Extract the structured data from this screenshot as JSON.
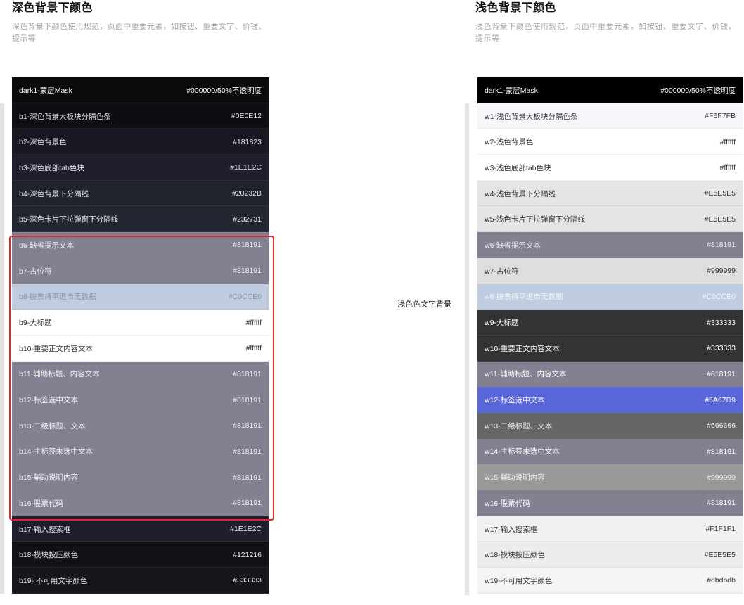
{
  "dark_panel": {
    "title": "深色背景下颜色",
    "description": "深色背景下颜色使用规范，页面中重要元素，如按钮、重要文字、价钱、提示等",
    "rows": [
      {
        "label": "dark1-蒙层Mask",
        "value": "#000000/50%不透明度",
        "bg": "#0b0b0e",
        "fg": "#ffffff"
      },
      {
        "label": "b1-深色背景大板块分隔色条",
        "value": "#0E0E12",
        "bg": "#0E0E12",
        "fg": "#e8e8ec"
      },
      {
        "label": "b2-深色背景色",
        "value": "#181823",
        "bg": "#181823",
        "fg": "#e8e8ec"
      },
      {
        "label": "b3-深色底部tab色块",
        "value": "#1E1E2C",
        "bg": "#1E1E2C",
        "fg": "#e8e8ec"
      },
      {
        "label": "b4-深色背景下分隔线",
        "value": "#20232B",
        "bg": "#20232B",
        "fg": "#e8e8ec"
      },
      {
        "label": "b5-深色卡片下拉弹窗下分隔线",
        "value": "#232731",
        "bg": "#232731",
        "fg": "#e8e8ec"
      },
      {
        "label": "b6-缺省提示文本",
        "value": "#818191",
        "bg": "#818191",
        "fg": "#f4f4f7"
      },
      {
        "label": "b7-占位符",
        "value": "#818191",
        "bg": "#818191",
        "fg": "#f4f4f7"
      },
      {
        "label": "b8-股票持平退市无数据",
        "value": "#C0CCE0",
        "bg": "#C0CCE0",
        "fg": "#8893a6"
      },
      {
        "label": "b9-大标题",
        "value": "#ffffff",
        "bg": "#ffffff",
        "fg": "#333333"
      },
      {
        "label": "b10-重要正文内容文本",
        "value": "#ffffff",
        "bg": "#ffffff",
        "fg": "#333333"
      },
      {
        "label": "b11-辅助标题、内容文本",
        "value": "#818191",
        "bg": "#818191",
        "fg": "#f4f4f7"
      },
      {
        "label": "b12-标签选中文本",
        "value": "#818191",
        "bg": "#818191",
        "fg": "#f4f4f7"
      },
      {
        "label": "b13-二级标题、文本",
        "value": "#818191",
        "bg": "#818191",
        "fg": "#f4f4f7"
      },
      {
        "label": "b14-主标签未选中文本",
        "value": "#818191",
        "bg": "#818191",
        "fg": "#f4f4f7"
      },
      {
        "label": "b15-辅助说明内容",
        "value": "#818191",
        "bg": "#818191",
        "fg": "#f4f4f7"
      },
      {
        "label": "b16-股票代码",
        "value": "#818191",
        "bg": "#818191",
        "fg": "#f4f4f7"
      },
      {
        "label": "b17-输入搜索框",
        "value": "#1E1E2C",
        "bg": "#1E1E2C",
        "fg": "#e8e8ec"
      },
      {
        "label": "b18-模块按压颜色",
        "value": "#121216",
        "bg": "#121216",
        "fg": "#e8e8ec"
      },
      {
        "label": "b19- 不可用文字颜色",
        "value": "#333333",
        "bg": "#16161b",
        "fg": "#e8e8ec"
      }
    ]
  },
  "light_panel": {
    "title": "浅色背景下颜色",
    "description": "浅色背景下颜色使用规范，页面中重要元素，如按钮、重要文字、价钱、提示等",
    "rows": [
      {
        "label": "dark1-蒙层Mask",
        "value": "#000000/50%不透明度",
        "bg": "#000000",
        "fg": "#ffffff"
      },
      {
        "label": "w1-浅色背景大板块分隔色条",
        "value": "#F6F7FB",
        "bg": "#F6F7FB",
        "fg": "#333333"
      },
      {
        "label": "w2-浅色背景色",
        "value": "#ffffff",
        "bg": "#ffffff",
        "fg": "#333333"
      },
      {
        "label": "w3-浅色底部tab色块",
        "value": "#ffffff",
        "bg": "#ffffff",
        "fg": "#333333"
      },
      {
        "label": "w4-浅色背景下分隔线",
        "value": "#E5E5E5",
        "bg": "#E5E5E5",
        "fg": "#333333"
      },
      {
        "label": "w5-浅色卡片下拉弹窗下分隔线",
        "value": "#E5E5E5",
        "bg": "#E5E5E5",
        "fg": "#333333"
      },
      {
        "label": "w6-缺省提示文本",
        "value": "#818191",
        "bg": "#818191",
        "fg": "#eeeef2"
      },
      {
        "label": "w7-占位符",
        "value": "#999999",
        "bg": "#dedede",
        "fg": "#333333"
      },
      {
        "label": "w8-股票持平退市无数据",
        "value": "#C0CCE0",
        "bg": "#C0CCE0",
        "fg": "#f4f6fa"
      },
      {
        "label": "w9-大标题",
        "value": "#333333",
        "bg": "#333333",
        "fg": "#ffffff"
      },
      {
        "label": "w10-重要正文内容文本",
        "value": "#333333",
        "bg": "#333333",
        "fg": "#ffffff"
      },
      {
        "label": "w11-辅助标题、内容文本",
        "value": "#818191",
        "bg": "#818191",
        "fg": "#ffffff"
      },
      {
        "label": "w12-标签选中文本",
        "value": "#5A67D9",
        "bg": "#5A67D9",
        "fg": "#ffffff"
      },
      {
        "label": "w13-二级标题、文本",
        "value": "#666666",
        "bg": "#666666",
        "fg": "#f0f0f0"
      },
      {
        "label": "w14-主标签未选中文本",
        "value": "#818191",
        "bg": "#818191",
        "fg": "#ffffff"
      },
      {
        "label": "w15-辅助说明内容",
        "value": "#999999",
        "bg": "#999999",
        "fg": "#f2f2f2"
      },
      {
        "label": "w16-股票代码",
        "value": "#818191",
        "bg": "#818191",
        "fg": "#ffffff"
      },
      {
        "label": "w17-输入搜索框",
        "value": "#F1F1F1",
        "bg": "#F1F1F1",
        "fg": "#333333"
      },
      {
        "label": "w18-模块按压颜色",
        "value": "#E5E5E5",
        "bg": "#ececec",
        "fg": "#333333"
      },
      {
        "label": "w19-不可用文字颜色",
        "value": "#dbdbdb",
        "bg": "#f5f5f5",
        "fg": "#333333"
      }
    ]
  },
  "middle_label": "浅色色文字背景",
  "highlight_box": {
    "color": "#e3262b"
  }
}
